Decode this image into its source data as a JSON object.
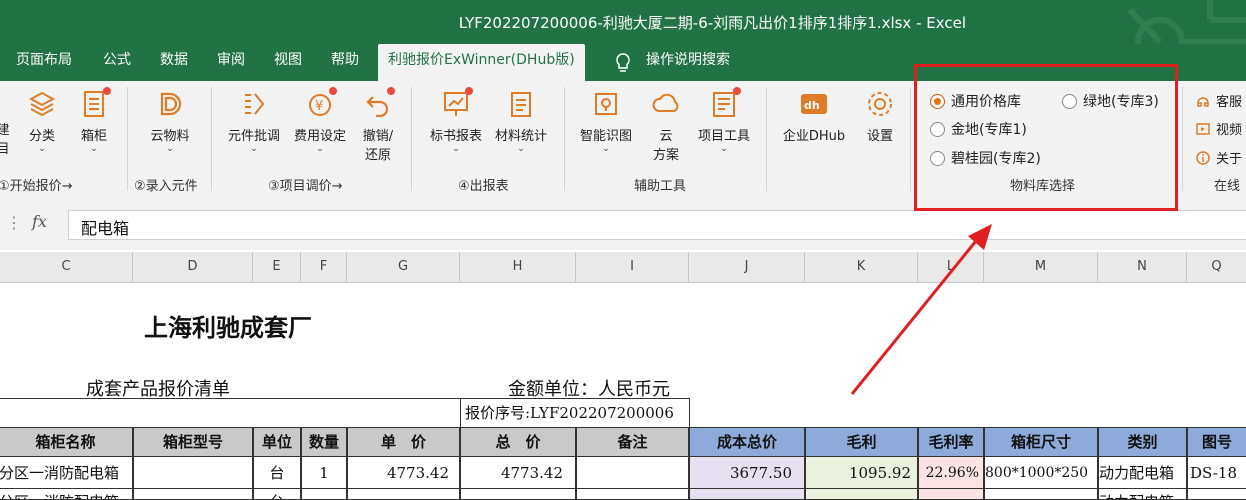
{
  "window": {
    "title": "LYF202207200006-利驰大厦二期-6-刘雨凡出价1排序1排序1.xlsx  -  Excel"
  },
  "tabs": [
    {
      "label": "页面布局",
      "active": false
    },
    {
      "label": "公式",
      "active": false
    },
    {
      "label": "数据",
      "active": false
    },
    {
      "label": "审阅",
      "active": false
    },
    {
      "label": "视图",
      "active": false
    },
    {
      "label": "帮助",
      "active": false
    },
    {
      "label": "利驰报价ExWinner(DHub版)",
      "active": true
    },
    {
      "label": "操作说明搜索",
      "active": false
    }
  ],
  "ribbon": {
    "buttons": [
      {
        "label": "建",
        "label2": "目",
        "icon": "partial-icon"
      },
      {
        "label": "分类",
        "icon": "layers-icon"
      },
      {
        "label": "箱柜",
        "icon": "cabinet-icon"
      },
      {
        "label": "云物料",
        "icon": "cloud-material-icon"
      },
      {
        "label": "元件批调",
        "icon": "batch-adjust-icon"
      },
      {
        "label": "费用设定",
        "icon": "fee-icon"
      },
      {
        "label": "撤销/",
        "label2": "还原",
        "icon": "undo-icon"
      },
      {
        "label": "标书报表",
        "icon": "report-icon"
      },
      {
        "label": "材料统计",
        "icon": "stats-icon"
      },
      {
        "label": "智能识图",
        "icon": "recognize-icon"
      },
      {
        "label": "云",
        "label2": "方案",
        "icon": "cloud-scheme-icon"
      },
      {
        "label": "项目工具",
        "icon": "project-tool-icon"
      },
      {
        "label": "企业DHub",
        "icon": "dhub-icon"
      },
      {
        "label": "设置",
        "icon": "gear-icon"
      }
    ],
    "groups": [
      "①开始报价→",
      "②录入元件",
      "③项目调价→",
      "④出报表",
      "辅助工具",
      "物料库选择",
      "在线"
    ],
    "radios": [
      {
        "label": "通用价格库",
        "checked": true
      },
      {
        "label": "绿地(专库3)",
        "checked": false
      },
      {
        "label": "金地(专库1)",
        "checked": false
      },
      {
        "label": "碧桂园(专库2)",
        "checked": false
      }
    ],
    "right_items": [
      "客服",
      "视频",
      "关于"
    ]
  },
  "formula_bar": {
    "fx": "fx",
    "value": "配电箱"
  },
  "columns": [
    "C",
    "D",
    "E",
    "F",
    "G",
    "H",
    "I",
    "J",
    "K",
    "L",
    "M",
    "N",
    "Q"
  ],
  "sheet": {
    "company": "上海利驰成套厂",
    "list_title": "成套产品报价清单",
    "currency": "金额单位：人民币元",
    "quote_no": "报价序号:LYF202207200006",
    "headers": [
      "箱柜名称",
      "箱柜型号",
      "单位",
      "数量",
      "单　价",
      "总　价",
      "备注",
      "成本总价",
      "毛利",
      "毛利率",
      "箱柜尺寸",
      "类别",
      "图号"
    ],
    "rows": [
      [
        "分区一消防配电箱",
        "",
        "台",
        "1",
        "4773.42",
        "4773.42",
        "",
        "3677.50",
        "1095.92",
        "22.96%",
        "800*1000*250",
        "动力配电箱",
        "DS-18"
      ],
      [
        "分区一消防配电箱",
        "",
        "台",
        "",
        "",
        "",
        "",
        "",
        "",
        "",
        "",
        "动力配电箱",
        ""
      ]
    ]
  },
  "colors": {
    "excel_green": "#217346",
    "highlight_red": "#e02020",
    "radio_orange": "#e8740c"
  }
}
